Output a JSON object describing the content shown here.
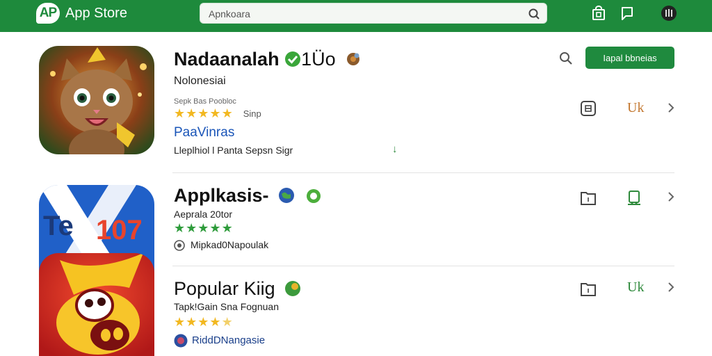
{
  "topbar": {
    "logo_badge": "AP",
    "logo_text": "App Store",
    "search_value": "Apnkoara",
    "icons": [
      "store-bag-icon",
      "chat-icon",
      "profile-icon"
    ]
  },
  "header_actions": {
    "install_label": "Iapal bbneias"
  },
  "apps": [
    {
      "title": "Nadaanalah",
      "title_suffix": "1Üo",
      "subtitle": "Nolonesiai",
      "small": "Sepk Bas Poobloc",
      "stars_label": "Sinp",
      "stars": 5,
      "link": "PaaVinras",
      "meta": "Lleplhiol l Panta Sepsn Sigr",
      "download_mark": "↓",
      "action_text": "Uk"
    },
    {
      "title": "Applkasis-",
      "subtitle": "Aeprala 20tor",
      "stars": 5,
      "meta": "Mipkad0Napoulak"
    },
    {
      "title": "Popular Kiig",
      "subtitle": "Tapk!Gain Sna Fognuan",
      "stars": 4,
      "meta": "RiddDNangasie",
      "action_text": "Uk"
    }
  ],
  "colors": {
    "brand_green": "#1e8a3c",
    "star_gold": "#f2b821",
    "star_green": "#2f9c3c",
    "link_blue": "#1a55b8"
  }
}
